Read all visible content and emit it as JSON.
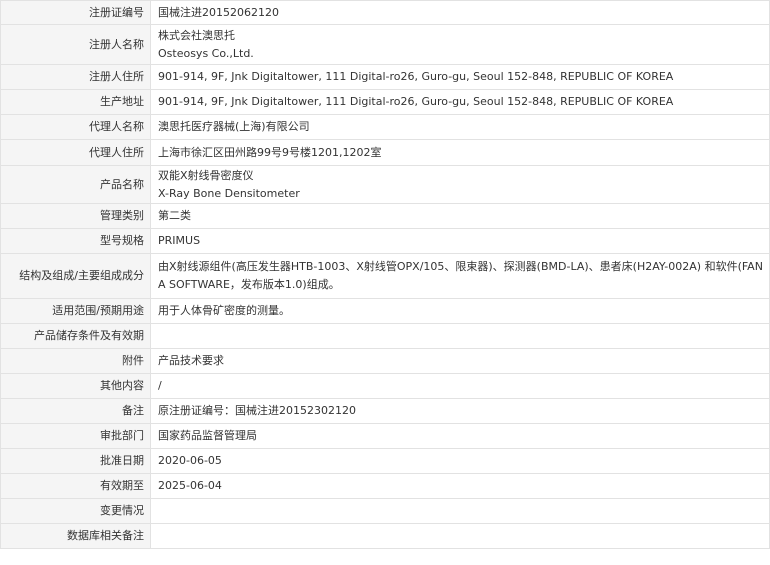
{
  "rows": [
    {
      "label": "注册证编号",
      "lines": [
        "国械注进20152062120"
      ]
    },
    {
      "label": "注册人名称",
      "lines": [
        "株式会社澳思托",
        "Osteosys Co.,Ltd."
      ]
    },
    {
      "label": "注册人住所",
      "lines": [
        "901-914, 9F, Jnk Digitaltower, 111 Digital-ro26, Guro-gu, Seoul 152-848, REPUBLIC OF KOREA"
      ]
    },
    {
      "label": "生产地址",
      "lines": [
        "901-914, 9F, Jnk Digitaltower, 111 Digital-ro26, Guro-gu, Seoul 152-848, REPUBLIC OF KOREA"
      ]
    },
    {
      "label": "代理人名称",
      "lines": [
        "澳思托医疗器械(上海)有限公司"
      ]
    },
    {
      "label": "代理人住所",
      "lines": [
        "上海市徐汇区田州路99号9号楼1201,1202室"
      ]
    },
    {
      "label": "产品名称",
      "lines": [
        "双能X射线骨密度仪",
        "X-Ray Bone Densitometer"
      ]
    },
    {
      "label": "管理类别",
      "lines": [
        "第二类"
      ]
    },
    {
      "label": "型号规格",
      "lines": [
        "PRIMUS"
      ]
    },
    {
      "label": "结构及组成/主要组成成分",
      "lines": [
        "由X射线源组件(高压发生器HTB-1003、X射线管OPX/105、限束器)、探测器(BMD-LA)、患者床(H2AY-002A) 和软件(FANA SOFTWARE，发布版本1.0)组成。"
      ]
    },
    {
      "label": "适用范围/预期用途",
      "lines": [
        "用于人体骨矿密度的测量。"
      ]
    },
    {
      "label": "产品储存条件及有效期",
      "lines": []
    },
    {
      "label": "附件",
      "lines": [
        "产品技术要求"
      ]
    },
    {
      "label": "其他内容",
      "lines": [
        "/"
      ]
    },
    {
      "label": "备注",
      "lines": [
        "原注册证编号：国械注进20152302120"
      ]
    },
    {
      "label": "审批部门",
      "lines": [
        "国家药品监督管理局"
      ]
    },
    {
      "label": "批准日期",
      "lines": [
        "2020-06-05"
      ]
    },
    {
      "label": "有效期至",
      "lines": [
        "2025-06-04"
      ]
    },
    {
      "label": "变更情况",
      "lines": []
    },
    {
      "label": "数据库相关备注",
      "lines": []
    }
  ]
}
